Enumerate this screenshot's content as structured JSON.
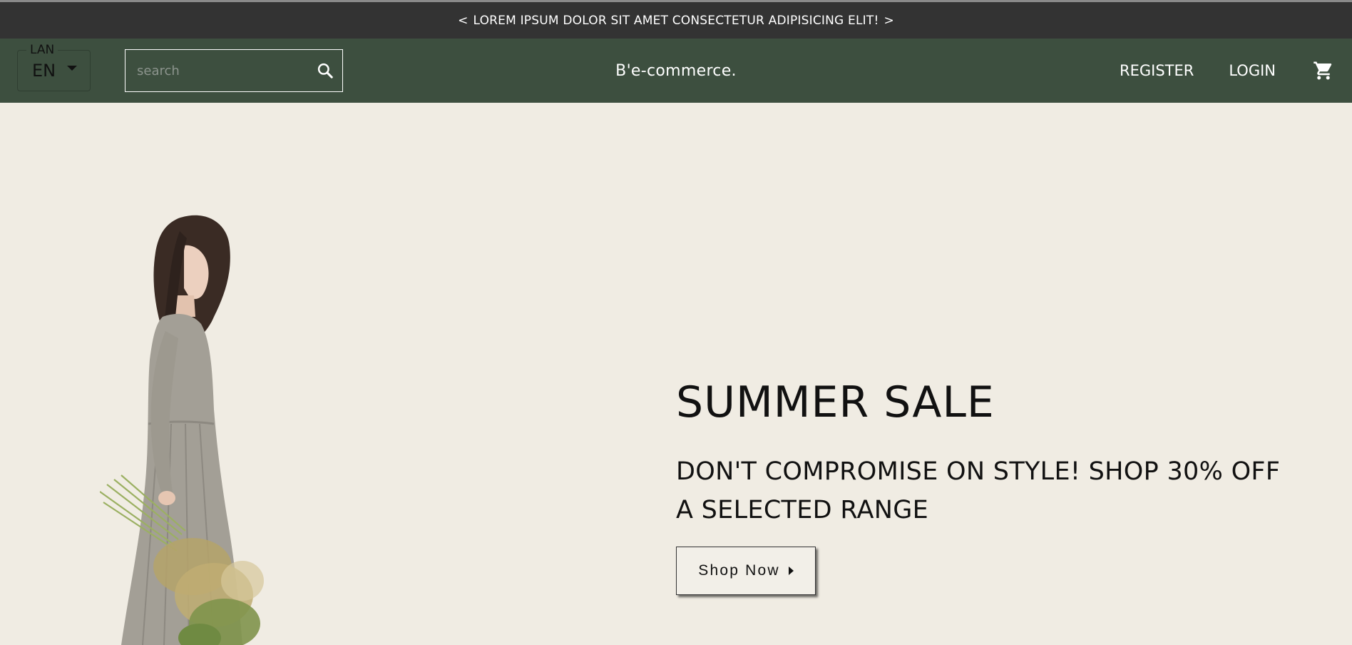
{
  "announcement": {
    "text": "LOREM IPSUM DOLOR SIT AMET CONSECTETUR ADIPISICING ELIT!",
    "prev_glyph": "<",
    "next_glyph": ">"
  },
  "navbar": {
    "language": {
      "label": "LAN",
      "value": "EN"
    },
    "search": {
      "placeholder": "search",
      "value": ""
    },
    "brand": "B'e-commerce.",
    "links": [
      "REGISTER",
      "LOGIN"
    ],
    "icons": {
      "search": "search-icon",
      "cart": "shopping-cart-icon"
    }
  },
  "hero": {
    "title": "SUMMER SALE",
    "subtitle": "DON'T COMPROMISE ON STYLE! SHOP 30% OFF A SELECTED RANGE",
    "cta_label": "Shop Now",
    "image": "woman-in-grey-dress-holding-flowers"
  },
  "colors": {
    "announcement_bg": "#333333",
    "navbar_bg": "#3d4f3f",
    "hero_bg": "#f0ece3",
    "text": "#111111"
  }
}
